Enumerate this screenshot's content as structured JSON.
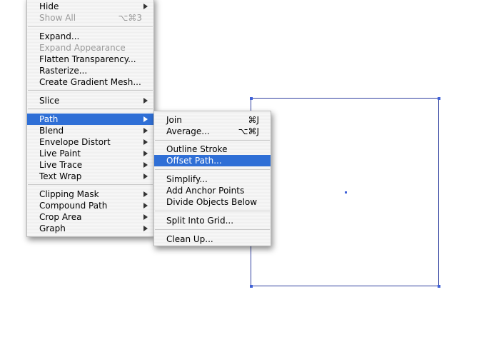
{
  "main_menu": {
    "items": [
      {
        "label": "Hide",
        "submenu": true,
        "enabled": true
      },
      {
        "label": "Show All",
        "shortcut": "⌥⌘3",
        "enabled": false
      },
      {
        "label": "Expand...",
        "enabled": true
      },
      {
        "label": "Expand Appearance",
        "enabled": false
      },
      {
        "label": "Flatten Transparency...",
        "enabled": true
      },
      {
        "label": "Rasterize...",
        "enabled": true
      },
      {
        "label": "Create Gradient Mesh...",
        "enabled": true
      },
      {
        "label": "Slice",
        "submenu": true,
        "enabled": true
      },
      {
        "label": "Path",
        "submenu": true,
        "enabled": true,
        "selected": true
      },
      {
        "label": "Blend",
        "submenu": true,
        "enabled": true
      },
      {
        "label": "Envelope Distort",
        "submenu": true,
        "enabled": true
      },
      {
        "label": "Live Paint",
        "submenu": true,
        "enabled": true
      },
      {
        "label": "Live Trace",
        "submenu": true,
        "enabled": true
      },
      {
        "label": "Text Wrap",
        "submenu": true,
        "enabled": true
      },
      {
        "label": "Clipping Mask",
        "submenu": true,
        "enabled": true
      },
      {
        "label": "Compound Path",
        "submenu": true,
        "enabled": true
      },
      {
        "label": "Crop Area",
        "submenu": true,
        "enabled": true
      },
      {
        "label": "Graph",
        "submenu": true,
        "enabled": true
      }
    ]
  },
  "path_submenu": {
    "items": [
      {
        "label": "Join",
        "shortcut": "⌘J"
      },
      {
        "label": "Average...",
        "shortcut": "⌥⌘J"
      },
      {
        "label": "Outline Stroke"
      },
      {
        "label": "Offset Path...",
        "selected": true
      },
      {
        "label": "Simplify..."
      },
      {
        "label": "Add Anchor Points"
      },
      {
        "label": "Divide Objects Below"
      },
      {
        "label": "Split Into Grid..."
      },
      {
        "label": "Clean Up..."
      }
    ]
  },
  "colors": {
    "selection": "#2f6fd6",
    "artboard_border": "#2f3f9f",
    "anchor": "#3f61d8"
  }
}
